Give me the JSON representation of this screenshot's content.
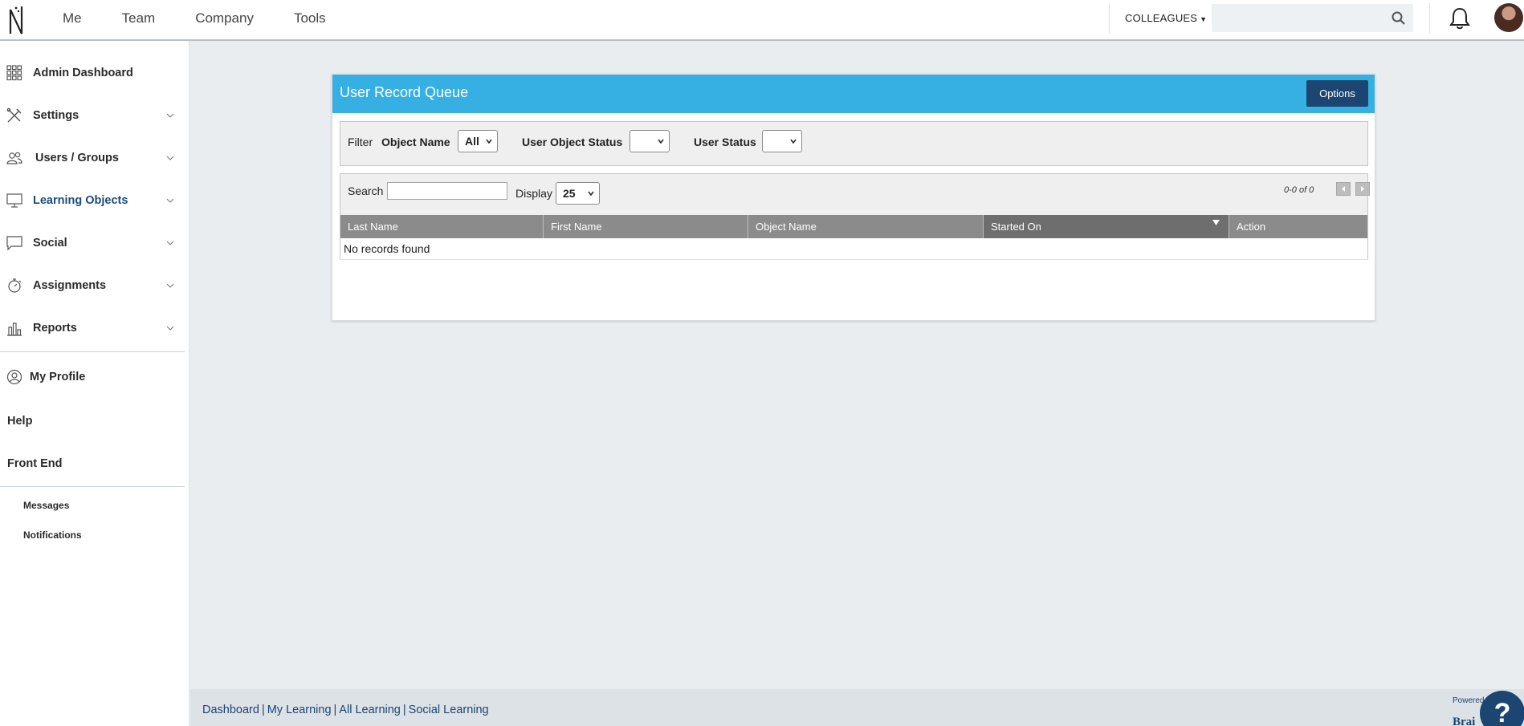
{
  "topbar": {
    "nav": [
      "Me",
      "Team",
      "Company",
      "Tools"
    ],
    "colleagues_label": "COLLEAGUES",
    "search_placeholder": ""
  },
  "sidebar": {
    "items": [
      {
        "label": "Admin Dashboard",
        "icon": "grid-icon"
      },
      {
        "label": "Settings",
        "icon": "tools-icon"
      },
      {
        "label": "Users / Groups",
        "icon": "users-icon"
      },
      {
        "label": "Learning Objects",
        "icon": "monitor-icon"
      },
      {
        "label": "Social",
        "icon": "chat-icon"
      },
      {
        "label": "Assignments",
        "icon": "stopwatch-icon"
      },
      {
        "label": "Reports",
        "icon": "bar-chart-icon"
      }
    ],
    "profile_label": "My Profile",
    "help_label": "Help",
    "frontend_label": "Front End",
    "messages_label": "Messages",
    "notifications_label": "Notifications"
  },
  "panel": {
    "title": "User Record Queue",
    "options_label": "Options",
    "filter": {
      "filter_label": "Filter",
      "object_name_label": "Object Name",
      "object_name_value": "All",
      "user_object_status_label": "User Object Status",
      "user_object_status_value": "",
      "user_status_label": "User Status",
      "user_status_value": ""
    },
    "table": {
      "search_label": "Search",
      "search_value": "",
      "display_label": "Display",
      "display_value": "25",
      "count": "0-0 of 0",
      "columns": [
        "Last Name",
        "First Name",
        "Object Name",
        "Started On",
        "Action"
      ],
      "sorted_column": "Started On",
      "empty_text": "No records found"
    }
  },
  "footer": {
    "links": [
      "Dashboard",
      "My Learning",
      "All Learning",
      "Social Learning"
    ],
    "powered": "Powered",
    "brand": "Brai"
  },
  "help_fab": "?",
  "colors": {
    "header_blue": "#36afe2",
    "navy": "#1c4572",
    "table_header": "#8b8b8b"
  }
}
